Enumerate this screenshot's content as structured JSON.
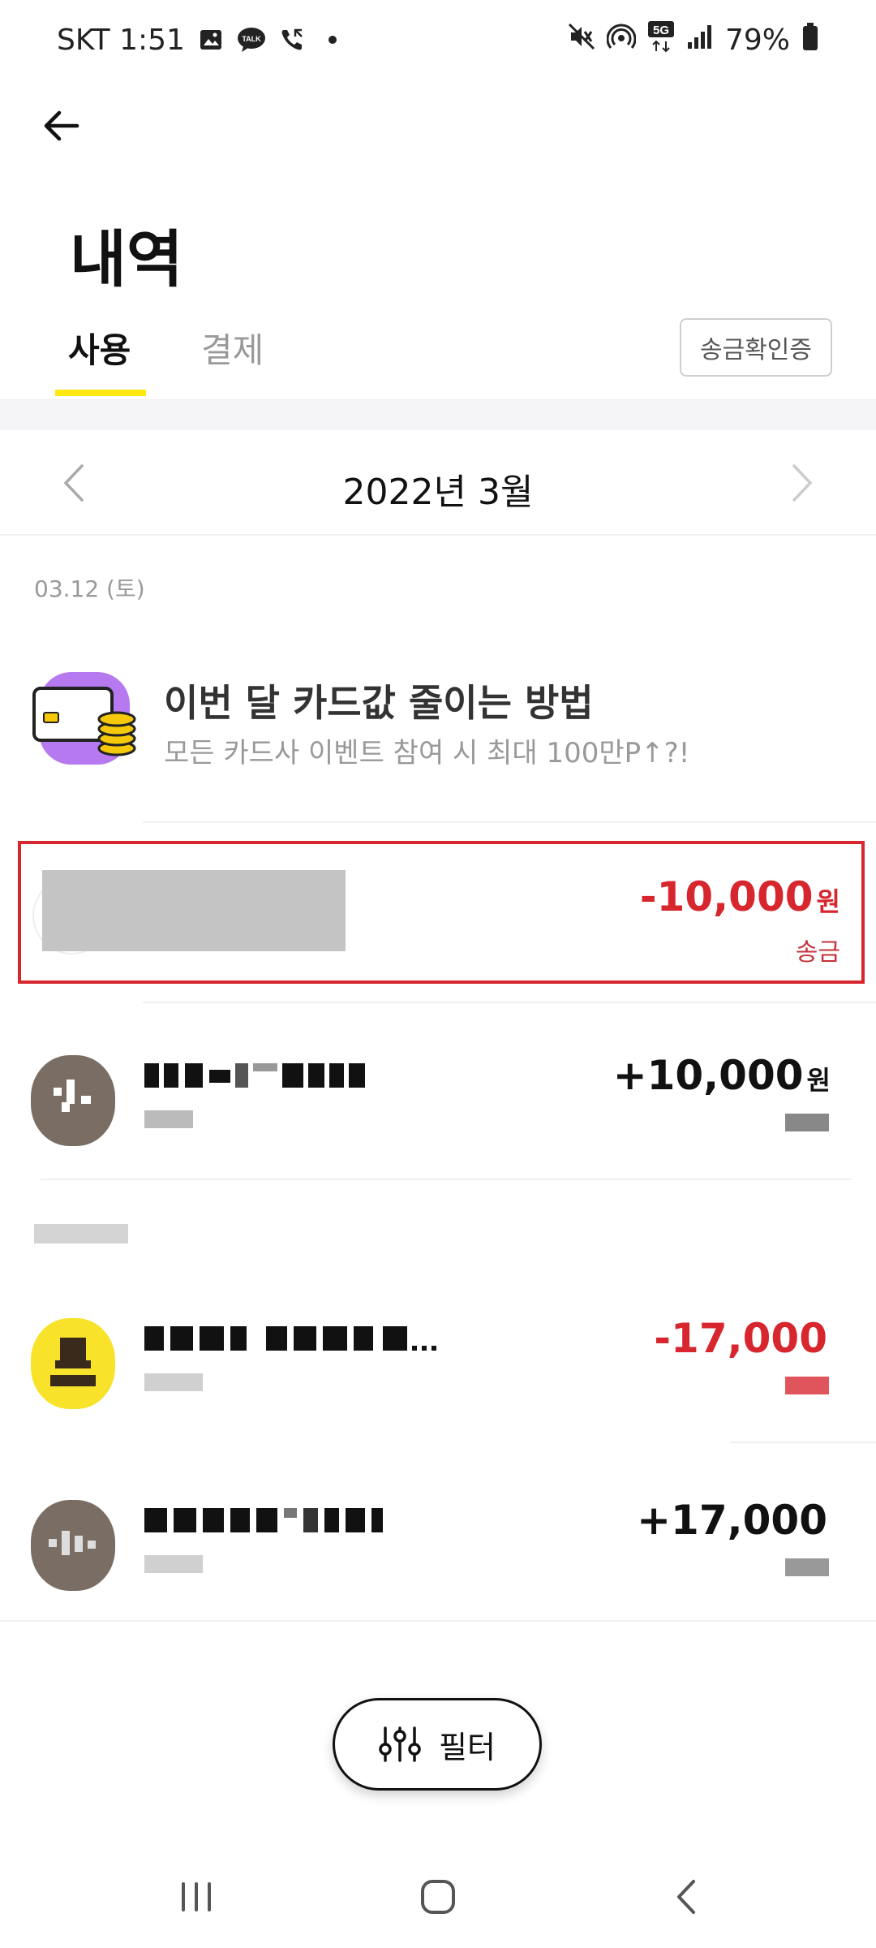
{
  "status_bar": {
    "carrier_time": "SKT 1:51",
    "left_icons": [
      "gallery-icon",
      "talk-icon",
      "missed-call-icon",
      "dot-icon"
    ],
    "network": "5G",
    "battery": "79%"
  },
  "header": {
    "title": "내역"
  },
  "tabs": [
    {
      "label": "사용",
      "active": true
    },
    {
      "label": "결제",
      "active": false
    }
  ],
  "verify_button": "송금확인증",
  "month_nav": {
    "label": "2022년 3월"
  },
  "date_header": "03.12 (토)",
  "promo": {
    "title": "이번 달 카드값 줄이는 방법",
    "subtitle": "모든 카드사 이벤트 참여 시 최대 100만P↑?!"
  },
  "transactions": [
    {
      "name": "",
      "sub": "",
      "amount": "-10,000",
      "unit": "원",
      "type": "송금",
      "negative": true,
      "highlighted": true
    },
    {
      "name": "",
      "sub": "",
      "amount": "+10,000",
      "unit": "원",
      "type": "",
      "negative": false,
      "highlighted": false
    },
    {
      "name": "",
      "sub": "",
      "amount": "-17,000",
      "unit": "",
      "type": "",
      "negative": true,
      "highlighted": false
    },
    {
      "name": "",
      "sub": "",
      "amount": "+17,000",
      "unit": "",
      "type": "",
      "negative": false,
      "highlighted": false
    }
  ],
  "section2_label": "",
  "filter_button": "필터",
  "colors": {
    "accent": "#ffe812",
    "negative": "#d7262e",
    "highlight_border": "#d7262e",
    "promo_icon_bg": "#b679f0"
  }
}
